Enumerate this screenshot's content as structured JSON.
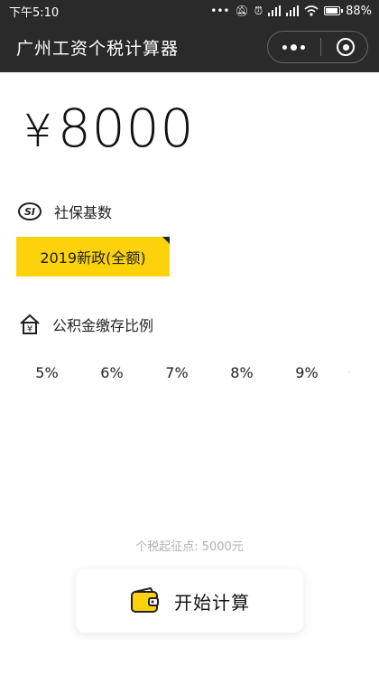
{
  "statusbar": {
    "time": "下午5:10",
    "battery": "88%",
    "battery_level": 0.88
  },
  "navbar": {
    "title": "广州工资个税计算器"
  },
  "salary": {
    "currency": "¥",
    "amount": "8000"
  },
  "social_security": {
    "icon_text": "SI",
    "label": "社保基数",
    "policy": "2019新政(全额)"
  },
  "housing_fund": {
    "icon_text": "¥",
    "label": "公积金缴存比例",
    "rates": [
      "5%",
      "6%",
      "7%",
      "8%",
      "9%"
    ]
  },
  "footer": {
    "threshold": "个税起征点: 5000元",
    "calc_label": "开始计算"
  },
  "colors": {
    "bar_background": "#2a2a2a",
    "accent_yellow": "#fcd20a"
  }
}
